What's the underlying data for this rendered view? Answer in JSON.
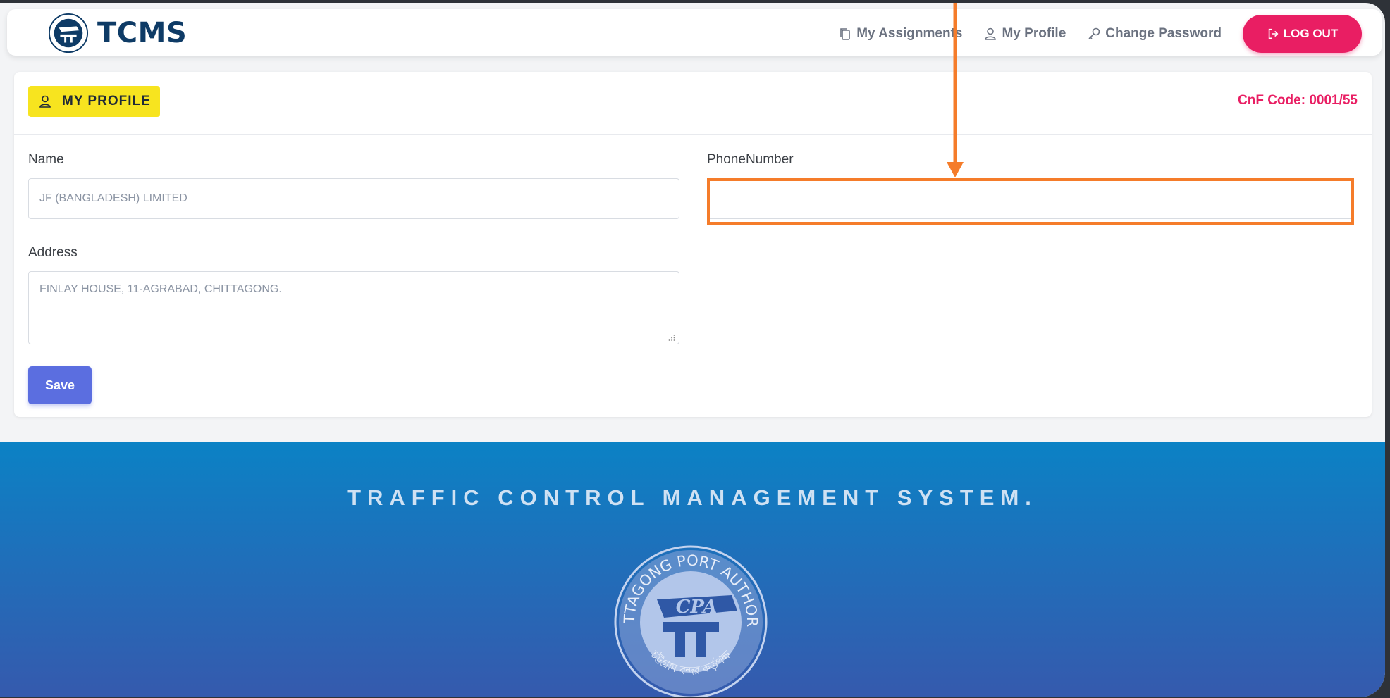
{
  "navbar": {
    "brand": "TCMS",
    "links": [
      {
        "label": "My Assignments",
        "icon": "copy-icon"
      },
      {
        "label": "My Profile",
        "icon": "user-icon"
      },
      {
        "label": "Change Password",
        "icon": "key-icon"
      }
    ],
    "logout_label": "LOG OUT"
  },
  "card": {
    "badge_label": "MY PROFILE",
    "cnf_code": "CnF Code: 0001/55"
  },
  "form": {
    "name_label": "Name",
    "name_value": "JF (BANGLADESH) LIMITED",
    "phone_label": "PhoneNumber",
    "phone_value": "",
    "address_label": "Address",
    "address_value": "FINLAY HOUSE, 11-AGRABAD, CHITTAGONG.",
    "save_label": "Save"
  },
  "footer": {
    "title": "TRAFFIC CONTROL MANAGEMENT SYSTEM.",
    "seal_text": "CHITTAGONG PORT AUTHORITY",
    "seal_initials": "CPA",
    "seal_bangla": "চট্টগ্রাম বন্দর কর্তৃপক্ষ"
  },
  "colors": {
    "accent_pink": "#e91e63",
    "badge_yellow": "#f7e41f",
    "save_blue": "#5b6ee0",
    "annotation_orange": "#f57c2a",
    "brand_navy": "#0e3b66"
  }
}
